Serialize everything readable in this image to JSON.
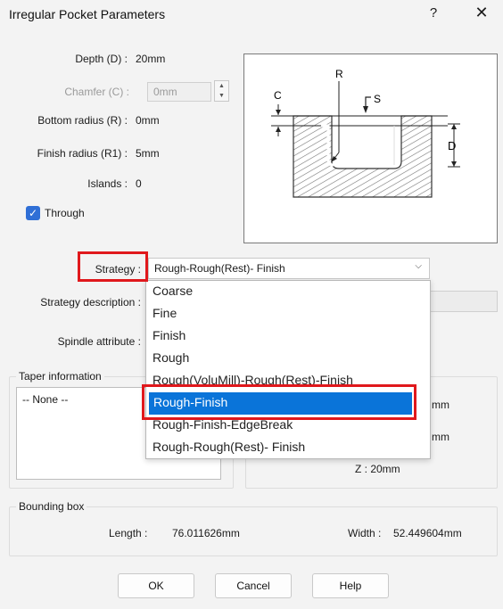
{
  "window": {
    "title": "Irregular Pocket Parameters",
    "help": "?",
    "close": "✕"
  },
  "params": {
    "depth_label": "Depth (D) :",
    "depth_value": "20mm",
    "chamfer_label": "Chamfer (C) :",
    "chamfer_value": "0mm",
    "bottom_radius_label": "Bottom radius (R) :",
    "bottom_radius_value": "0mm",
    "finish_radius_label": "Finish radius (R1) :",
    "finish_radius_value": "5mm",
    "islands_label": "Islands :",
    "islands_value": "0",
    "through_label": "Through",
    "through_checked": true
  },
  "diagram": {
    "label_c": "C",
    "label_r": "R",
    "label_s": "S",
    "label_d": "D"
  },
  "strategy": {
    "label": "Strategy :",
    "selected": "Rough-Rough(Rest)- Finish",
    "description_label": "Strategy description :",
    "spindle_label": "Spindle attribute :",
    "options": [
      "Coarse",
      "Fine",
      "Finish",
      "Rough",
      "Rough(VoluMill)-Rough(Rest)-Finish",
      "Rough-Finish",
      "Rough-Finish-EdgeBreak",
      "Rough-Rough(Rest)- Finish"
    ],
    "highlighted": "Rough-Finish"
  },
  "taper": {
    "title": "Taper information",
    "list_item": "-- None --"
  },
  "position": {
    "x_suffix": "mm",
    "y_suffix": "mm",
    "z_text": "Z : 20mm"
  },
  "bounding_box": {
    "title": "Bounding box",
    "length_label": "Length :",
    "length_value": "76.011626mm",
    "width_label": "Width :",
    "width_value": "52.449604mm"
  },
  "buttons": {
    "ok": "OK",
    "cancel": "Cancel",
    "help": "Help"
  },
  "colors": {
    "accent": "#0a74d9",
    "checkbox": "#2f6fd6",
    "highlight_box": "#e0181c"
  }
}
